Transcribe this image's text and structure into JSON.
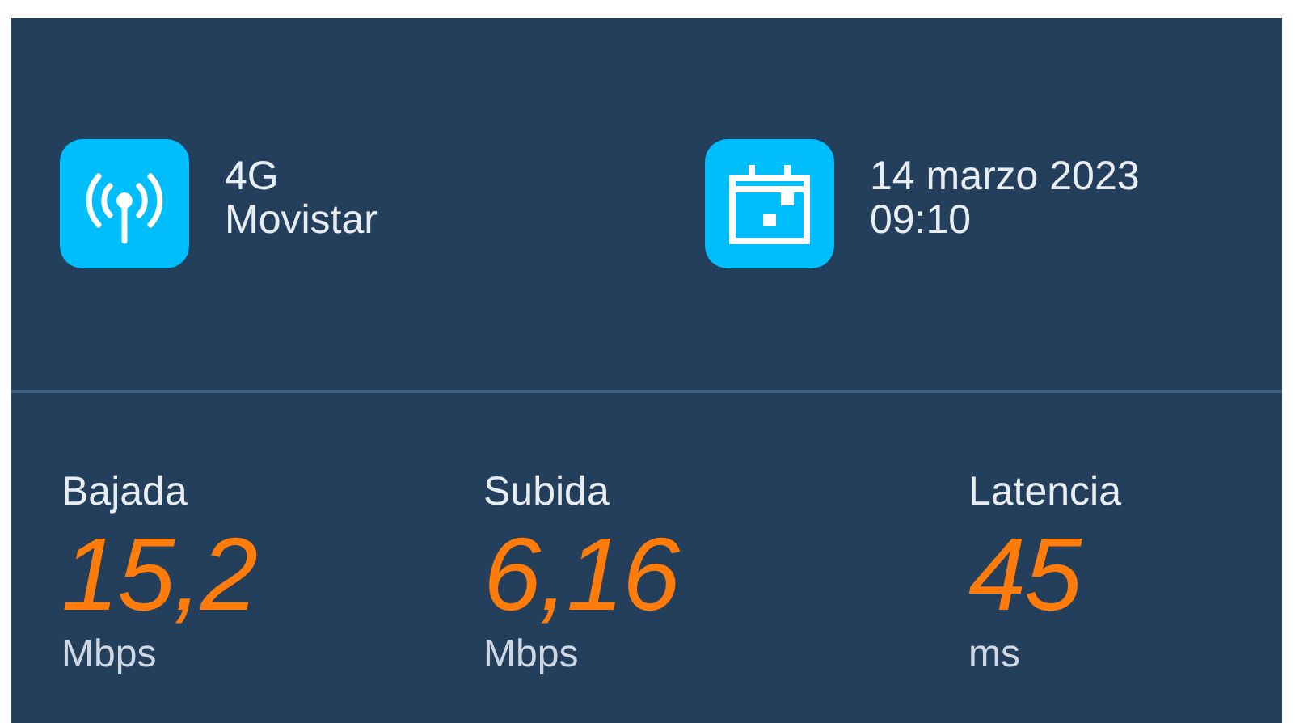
{
  "connection": {
    "lines": [
      "4G",
      "Movistar"
    ]
  },
  "test_time": {
    "lines": [
      "14 marzo 2023",
      "09:10"
    ]
  },
  "stats": [
    {
      "label": "Bajada",
      "value": "15,2",
      "unit": "Mbps"
    },
    {
      "label": "Subida",
      "value": "6,16",
      "unit": "Mbps"
    },
    {
      "label": "Latencia",
      "value": "45",
      "unit": "ms"
    }
  ]
}
